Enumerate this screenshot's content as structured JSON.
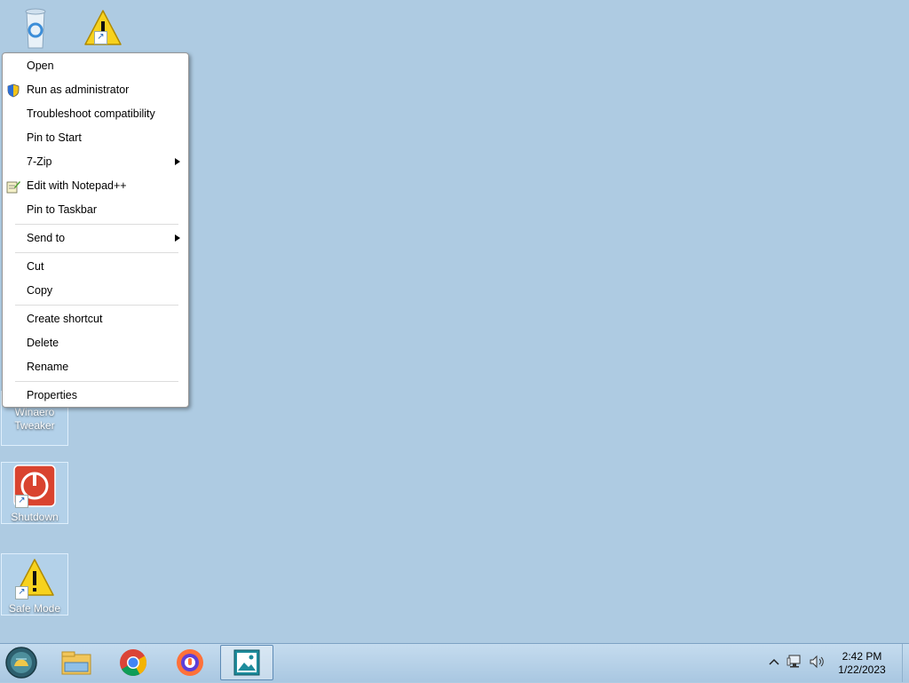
{
  "desktop": {
    "icons": [
      {
        "name": "Winaero Tweaker",
        "line1": "Winaero",
        "line2": "Tweaker"
      },
      {
        "name": "Shutdown",
        "line1": "Shutdown"
      },
      {
        "name": "Safe Mode",
        "line1": "Safe Mode"
      }
    ]
  },
  "context_menu": {
    "items": [
      {
        "label": "Open"
      },
      {
        "label": "Run as administrator",
        "icon": "uac-shield-icon"
      },
      {
        "label": "Troubleshoot compatibility"
      },
      {
        "label": "Pin to Start"
      },
      {
        "label": "7-Zip",
        "submenu": true
      },
      {
        "label": "Edit with Notepad++",
        "icon": "notepadpp-icon"
      },
      {
        "label": "Pin to Taskbar"
      },
      {
        "label": "Send to",
        "submenu": true
      },
      {
        "label": "Cut"
      },
      {
        "label": "Copy"
      },
      {
        "label": "Create shortcut"
      },
      {
        "label": "Delete"
      },
      {
        "label": "Rename"
      },
      {
        "label": "Properties"
      }
    ]
  },
  "taskbar": {
    "apps": [
      "start-orb-icon",
      "file-explorer-icon",
      "chrome-icon",
      "firefox-icon",
      "image-viewer-icon"
    ],
    "clock": {
      "time": "2:42 PM",
      "date": "1/22/2023"
    }
  },
  "colors": {
    "desktop": "#aecbe2",
    "accent": "#1a5fb4"
  }
}
